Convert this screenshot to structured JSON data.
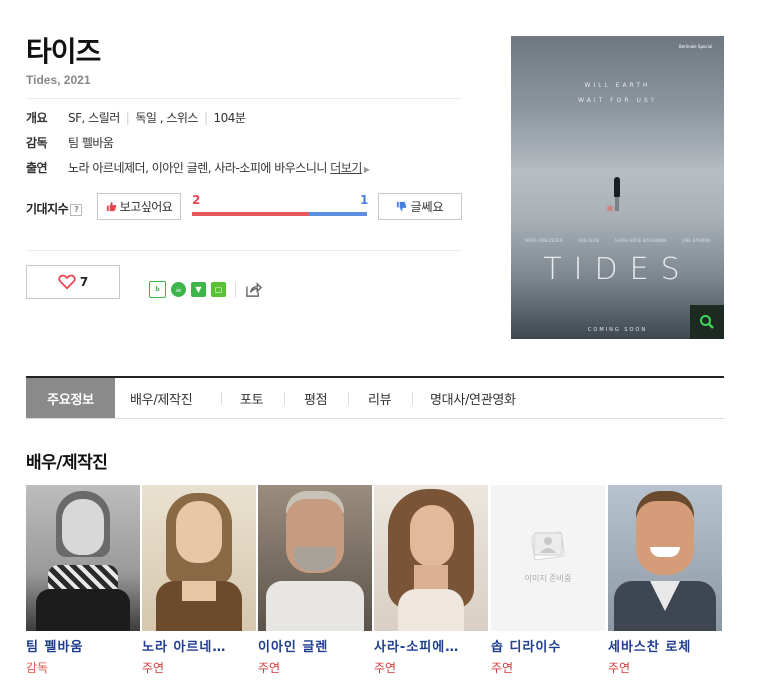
{
  "movie": {
    "title": "타이즈",
    "subtitle": "Tides, 2021",
    "info": {
      "overview_label": "개요",
      "genre": "SF, 스릴러",
      "country": "독일 , 스위스",
      "runtime": "104분",
      "director_label": "감독",
      "director": "팀 펠바움",
      "cast_label": "출연",
      "cast": "노라 아르네제더, 이아인 글렌, 사라-소피에 바우스니니",
      "more": "더보기"
    },
    "expect": {
      "label": "기대지수",
      "help": "?",
      "want_label": "보고싶어요",
      "no_label": "글쎄요",
      "want_count": "2",
      "no_count": "1",
      "want_ratio": 0.67
    },
    "likes": "7"
  },
  "share_icons": [
    "blog-icon",
    "cafe-icon",
    "bookmark-icon",
    "memo-icon"
  ],
  "poster": {
    "tagline_1": "WILL EARTH",
    "tagline_2": "WAIT FOR US?",
    "title_text": "TIDES",
    "coming_soon": "COMING SOON",
    "festival_badge": "Berlinale Special",
    "credit_names": [
      "NORA ARNEZEDER",
      "IAIN GLEN",
      "SARAH-SOFIE BOUSSNINA",
      "JOEL BASMAN"
    ]
  },
  "tabs": [
    "주요정보",
    "배우/제작진",
    "포토",
    "평점",
    "리뷰",
    "명대사/연관영화"
  ],
  "section_title": "배우/제작진",
  "cast_list": [
    {
      "name": "팀 펠바움",
      "role": "감독"
    },
    {
      "name": "노라 아르네…",
      "role": "주연"
    },
    {
      "name": "이아인 글렌",
      "role": "주연"
    },
    {
      "name": "사라-소피에…",
      "role": "주연"
    },
    {
      "name": "솝 디라이수",
      "role": "주연"
    },
    {
      "name": "세바스찬 로체",
      "role": "주연"
    }
  ],
  "placeholder_text": "이미지 준비중",
  "colors": {
    "want": "#e8585f",
    "no": "#5b8de0",
    "link": "#1e3d8f",
    "role": "#d03a3a"
  }
}
